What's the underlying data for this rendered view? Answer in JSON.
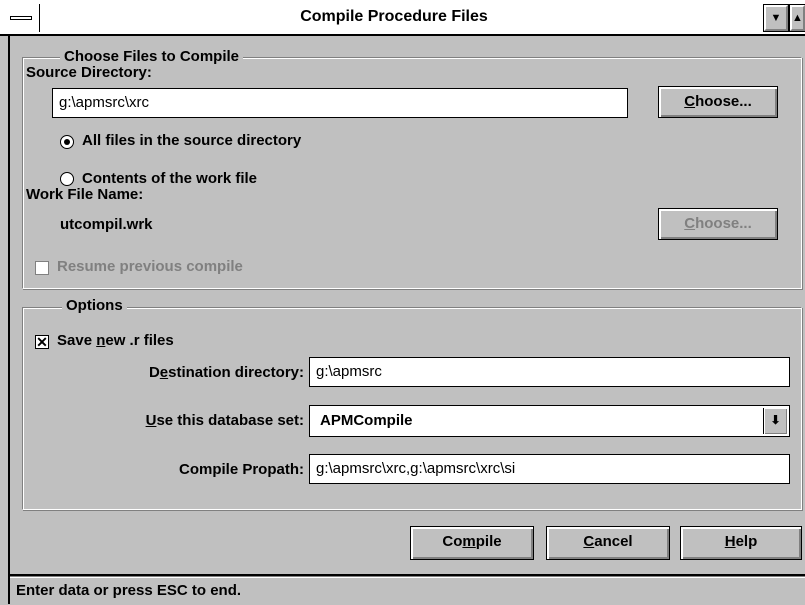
{
  "window": {
    "title": "Compile Procedure Files"
  },
  "titlebar_buttons": {
    "minimize": "▼",
    "maximize": "▲"
  },
  "files_group": {
    "label": "Choose Files to Compile",
    "source_dir_label": "Source Directory:",
    "source_dir_value": "g:\\apmsrc\\xrc",
    "choose_button": "Choose...",
    "radio_all": "All files in the source directory",
    "radio_work": "Contents of the work file",
    "radio_selected": "all",
    "work_file_label": "Work File Name:",
    "work_file_value": "utcompil.wrk",
    "choose_button_2": "Choose...",
    "resume_label": "Resume previous compile",
    "resume_checked": false
  },
  "options_group": {
    "label": "Options",
    "save_r_label": "Save new .r files",
    "save_r_checked": true,
    "dest_dir_label": "Destination directory:",
    "dest_dir_value": "g:\\apmsrc",
    "db_set_label": "Use this database set:",
    "db_set_value": "APMCompile",
    "propath_label": "Compile Propath:",
    "propath_value": "g:\\apmsrc\\xrc,g:\\apmsrc\\xrc\\si"
  },
  "buttons": {
    "compile": "Compile",
    "cancel": "Cancel",
    "help": "Help"
  },
  "status": {
    "text": "Enter data or press ESC to end."
  }
}
